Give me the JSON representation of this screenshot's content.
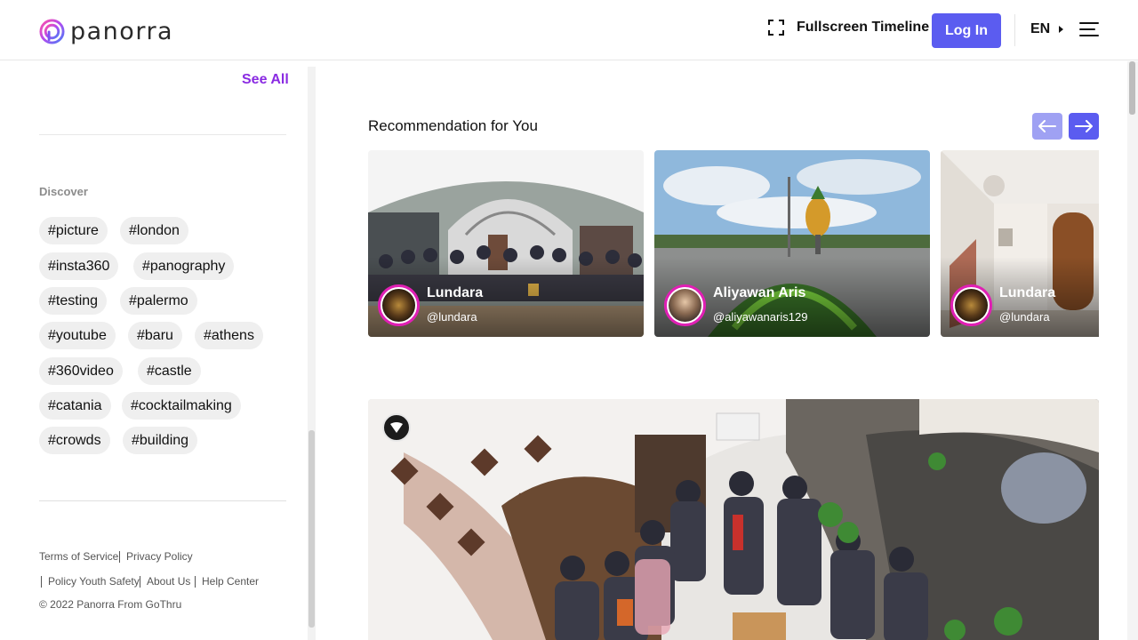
{
  "header": {
    "logo_text": "panorra",
    "fullscreen_label": "Fullscreen Timeline",
    "login_label": "Log In",
    "language": "EN",
    "icons": [
      "panorra-logo-icon",
      "fullscreen-icon",
      "caret-right-icon",
      "hamburger-menu-icon"
    ]
  },
  "sidebar": {
    "see_all_label": "See All",
    "discover_label": "Discover",
    "tags": [
      {
        "label": "#picture"
      },
      {
        "label": "#london"
      },
      {
        "label": "#insta360"
      },
      {
        "label": "#panography"
      },
      {
        "label": "#testing"
      },
      {
        "label": "#palermo"
      },
      {
        "label": "#youtube"
      },
      {
        "label": "#baru"
      },
      {
        "label": "#athens"
      },
      {
        "label": "#360video"
      },
      {
        "label": "#castle"
      },
      {
        "label": "#catania"
      },
      {
        "label": "#cocktailmaking"
      },
      {
        "label": "#crowds"
      },
      {
        "label": "#building"
      }
    ],
    "footer": {
      "terms": "Terms of Service",
      "privacy": "Privacy Policy",
      "youth_safety": "Policy Youth Safety",
      "about": "About Us",
      "help": "Help Center",
      "copyright": "© 2022 Panorra From GoThru"
    }
  },
  "main": {
    "recommendation_title": "Recommendation for You",
    "cards": [
      {
        "name": "Lundara",
        "handle": "@lundara"
      },
      {
        "name": "Aliyawan Aris",
        "handle": "@aliyawanaris129"
      },
      {
        "name": "Lundara",
        "handle": "@lundara"
      }
    ]
  },
  "colors": {
    "accent": "#5b5cf0",
    "accent_light": "#9fa1f3",
    "see_all": "#8a2be2",
    "avatar_ring": "#e01fb4",
    "tag_bg": "#efefef"
  }
}
